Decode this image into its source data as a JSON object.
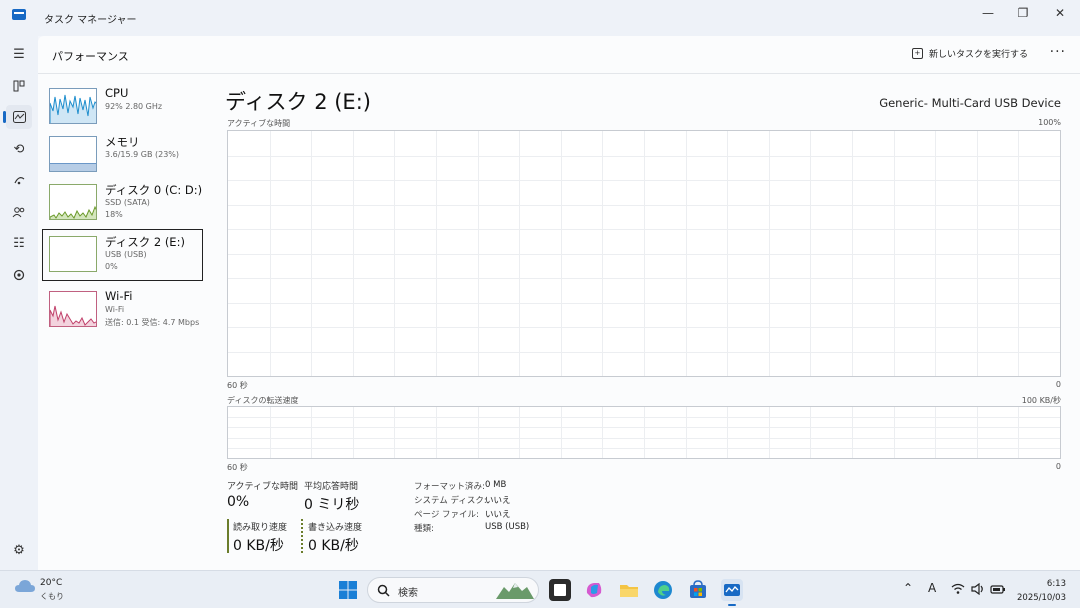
{
  "window": {
    "title": "タスク マネージャー",
    "controls": {
      "minimize": "—",
      "maximize": "❐",
      "close": "✕"
    }
  },
  "header": {
    "title": "パフォーマンス",
    "new_task_label": "新しいタスクを実行する",
    "more_label": "···"
  },
  "perf_list": [
    {
      "name": "CPU",
      "sub1": "92%  2.80 GHz",
      "sub2": ""
    },
    {
      "name": "メモリ",
      "sub1": "3.6/15.9 GB (23%)",
      "sub2": ""
    },
    {
      "name": "ディスク 0 (C: D:)",
      "sub1": "SSD (SATA)",
      "sub2": "18%"
    },
    {
      "name": "ディスク 2 (E:)",
      "sub1": "USB (USB)",
      "sub2": "0%"
    },
    {
      "name": "Wi-Fi",
      "sub1": "Wi-Fi",
      "sub2": "送信: 0.1 受信: 4.7 Mbps"
    }
  ],
  "detail": {
    "title": "ディスク 2 (E:)",
    "device": "Generic- Multi-Card USB Device",
    "graph1": {
      "label": "アクティブな時間",
      "max": "100%",
      "x_left": "60 秒",
      "x_right": "0"
    },
    "graph2": {
      "label": "ディスクの転送速度",
      "max": "100 KB/秒",
      "x_left": "60 秒",
      "x_right": "0"
    },
    "stats": {
      "active_label": "アクティブな時間",
      "active_value": "0%",
      "response_label": "平均応答時間",
      "response_value": "0 ミリ秒",
      "read_label": "読み取り速度",
      "read_value": "0 KB/秒",
      "write_label": "書き込み速度",
      "write_value": "0 KB/秒"
    },
    "info": [
      {
        "key": "フォーマット済み:",
        "value": "0 MB"
      },
      {
        "key": "システム ディスク:",
        "value": "いいえ"
      },
      {
        "key": "ページ ファイル:",
        "value": "いいえ"
      },
      {
        "key": "種類:",
        "value": "USB (USB)"
      }
    ]
  },
  "taskbar": {
    "weather_temp": "20°C",
    "weather_cond": "くもり",
    "search_placeholder": "検索",
    "time": "6:13",
    "date": "2025/10/03"
  },
  "colors": {
    "accent": "#1769c4",
    "cpu_line": "#1f8ecd",
    "memory_fill": "#b7cde6",
    "disk_line": "#6b9a2a",
    "wifi_line": "#c0406a"
  }
}
